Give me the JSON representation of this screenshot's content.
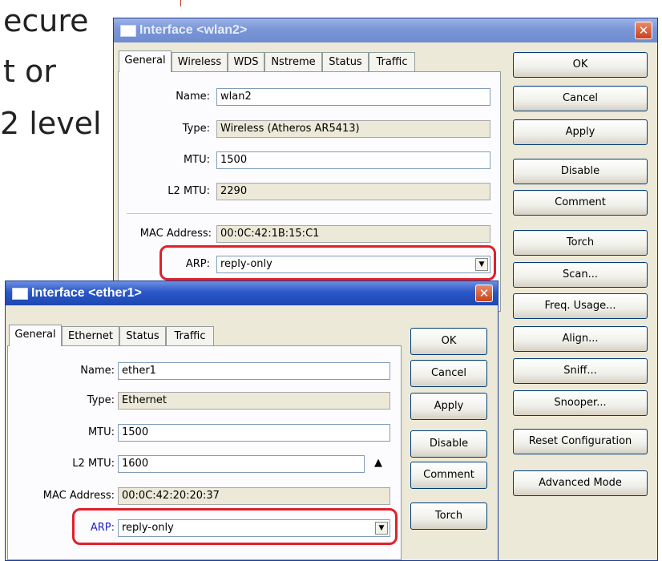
{
  "slide": {
    "lines": [
      "ecure",
      "t or",
      "2 level"
    ]
  },
  "wlan_window": {
    "title": "Interface <wlan2>",
    "close_glyph": "✕",
    "tabs": [
      "General",
      "Wireless",
      "WDS",
      "Nstreme",
      "Status",
      "Traffic"
    ],
    "active_tab": "General",
    "fields": {
      "name": {
        "label": "Name:",
        "value": "wlan2"
      },
      "type": {
        "label": "Type:",
        "value": "Wireless (Atheros AR5413)"
      },
      "mtu": {
        "label": "MTU:",
        "value": "1500"
      },
      "l2mtu": {
        "label": "L2 MTU:",
        "value": "2290"
      },
      "mac": {
        "label": "MAC Address:",
        "value": "00:0C:42:1B:15:C1"
      },
      "arp": {
        "label": "ARP:",
        "value": "reply-only"
      }
    },
    "buttons": [
      "OK",
      "Cancel",
      "Apply",
      "Disable",
      "Comment",
      "Torch",
      "Scan...",
      "Freq. Usage...",
      "Align...",
      "Sniff...",
      "Snooper...",
      "Reset Configuration",
      "Advanced Mode"
    ]
  },
  "ether_window": {
    "title": "Interface <ether1>",
    "close_glyph": "✕",
    "tabs": [
      "General",
      "Ethernet",
      "Status",
      "Traffic"
    ],
    "active_tab": "General",
    "fields": {
      "name": {
        "label": "Name:",
        "value": "ether1"
      },
      "type": {
        "label": "Type:",
        "value": "Ethernet"
      },
      "mtu": {
        "label": "MTU:",
        "value": "1500"
      },
      "l2mtu": {
        "label": "L2 MTU:",
        "value": "1600"
      },
      "mac": {
        "label": "MAC Address:",
        "value": "00:0C:42:20:20:37"
      },
      "arp": {
        "label": "ARP:",
        "value": "reply-only"
      }
    },
    "buttons": [
      "OK",
      "Cancel",
      "Apply",
      "Disable",
      "Comment",
      "Torch"
    ]
  },
  "icons": {
    "dropdown": "▼",
    "up_arrow": "▲"
  },
  "colors": {
    "titlebar": "#2a58c8",
    "highlight": "#e0202a",
    "arp_label_ether": "#2020c0"
  }
}
